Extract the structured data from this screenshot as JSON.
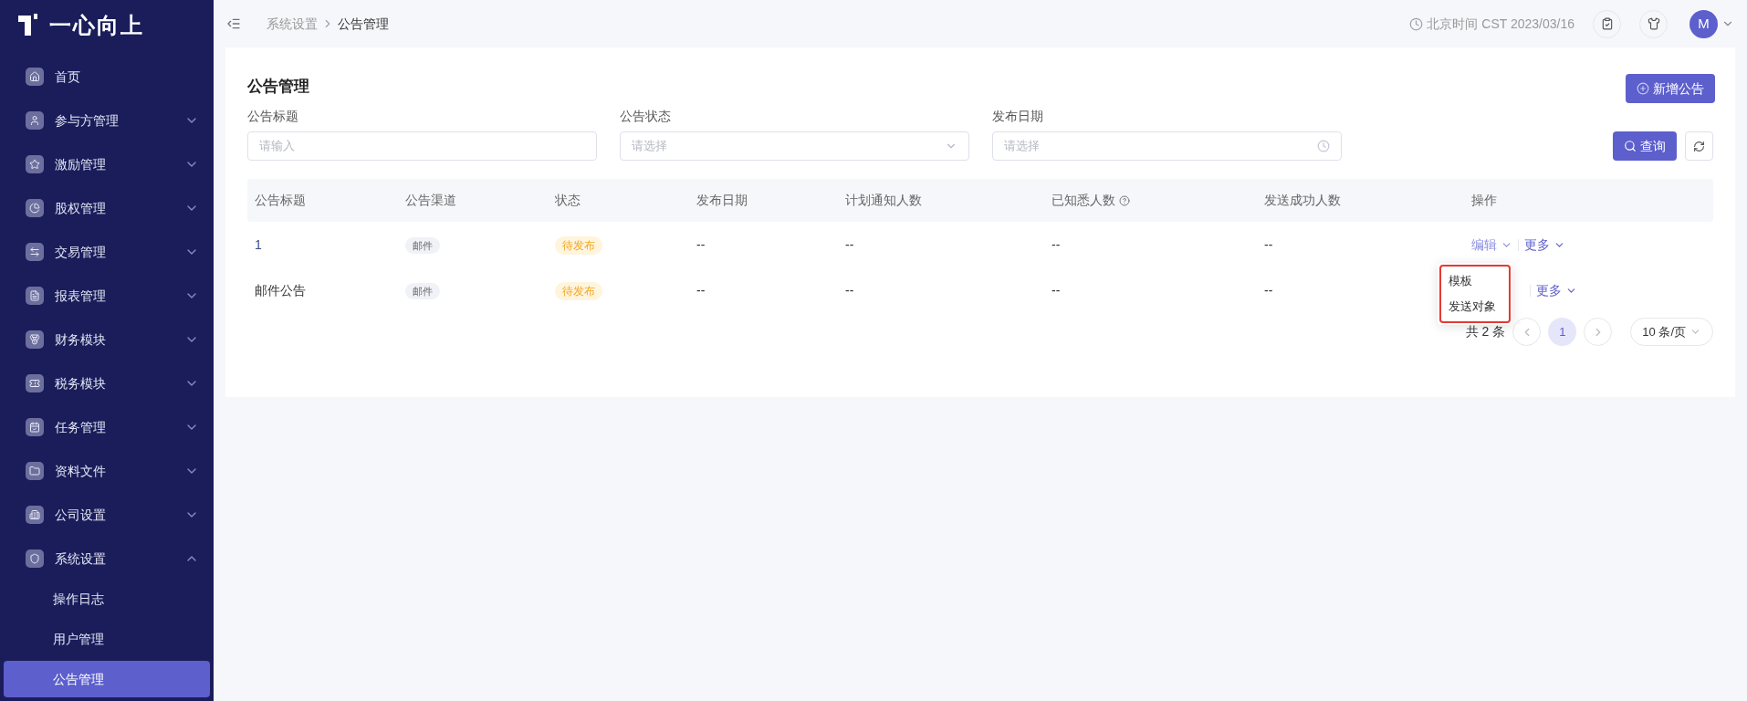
{
  "logo": {
    "text": "一心向上"
  },
  "sidebar": {
    "items": [
      {
        "kind": "link",
        "label": "首页"
      },
      {
        "kind": "group",
        "label": "参与方管理",
        "expanded": false
      },
      {
        "kind": "group",
        "label": "激励管理",
        "expanded": false
      },
      {
        "kind": "group",
        "label": "股权管理",
        "expanded": false
      },
      {
        "kind": "group",
        "label": "交易管理",
        "expanded": false
      },
      {
        "kind": "group",
        "label": "报表管理",
        "expanded": false
      },
      {
        "kind": "group",
        "label": "财务模块",
        "expanded": false
      },
      {
        "kind": "group",
        "label": "税务模块",
        "expanded": false
      },
      {
        "kind": "group",
        "label": "任务管理",
        "expanded": false
      },
      {
        "kind": "group",
        "label": "资料文件",
        "expanded": false
      },
      {
        "kind": "group",
        "label": "公司设置",
        "expanded": false
      },
      {
        "kind": "group",
        "label": "系统设置",
        "expanded": true,
        "children": [
          {
            "label": "操作日志",
            "selected": false
          },
          {
            "label": "用户管理",
            "selected": false
          },
          {
            "label": "公告管理",
            "selected": true
          }
        ]
      }
    ]
  },
  "header": {
    "breadcrumb": [
      {
        "label": "系统设置",
        "current": false
      },
      {
        "label": "公告管理",
        "current": true
      }
    ],
    "time": "北京时间 CST 2023/03/16",
    "avatar": "M"
  },
  "page": {
    "title": "公告管理",
    "add_button": "新增公告",
    "filters": [
      {
        "kind": "input",
        "label": "公告标题",
        "placeholder": "请输入"
      },
      {
        "kind": "select",
        "label": "公告状态",
        "placeholder": "请选择"
      },
      {
        "kind": "date",
        "label": "发布日期",
        "placeholder": "请选择"
      }
    ],
    "search_button": "查询"
  },
  "table": {
    "columns": [
      {
        "label": "公告标题",
        "help": false
      },
      {
        "label": "公告渠道",
        "help": false
      },
      {
        "label": "状态",
        "help": false
      },
      {
        "label": "发布日期",
        "help": false
      },
      {
        "label": "计划通知人数",
        "help": false
      },
      {
        "label": "已知悉人数",
        "help": true
      },
      {
        "label": "发送成功人数",
        "help": false
      },
      {
        "label": "操作",
        "help": false
      }
    ],
    "rows": [
      {
        "title": "1",
        "title_link": true,
        "channel": "邮件",
        "status": "待发布",
        "publish_date": "--",
        "planned": "--",
        "acknowledged": "--",
        "sent": "--",
        "actions": [
          {
            "kind": "edit",
            "label": "编辑"
          },
          {
            "kind": "more",
            "label": "更多"
          }
        ]
      },
      {
        "title": "邮件公告",
        "title_link": false,
        "channel": "邮件",
        "status": "待发布",
        "publish_date": "--",
        "planned": "--",
        "acknowledged": "--",
        "sent": "--",
        "actions": [
          {
            "kind": "more",
            "label": "更多"
          }
        ]
      }
    ]
  },
  "dropdown": {
    "items": [
      "模板",
      "发送对象"
    ]
  },
  "pagination": {
    "total": "共 2 条",
    "pages": [
      {
        "label": "1",
        "selected": true
      }
    ],
    "page_size": "10 条/页"
  }
}
